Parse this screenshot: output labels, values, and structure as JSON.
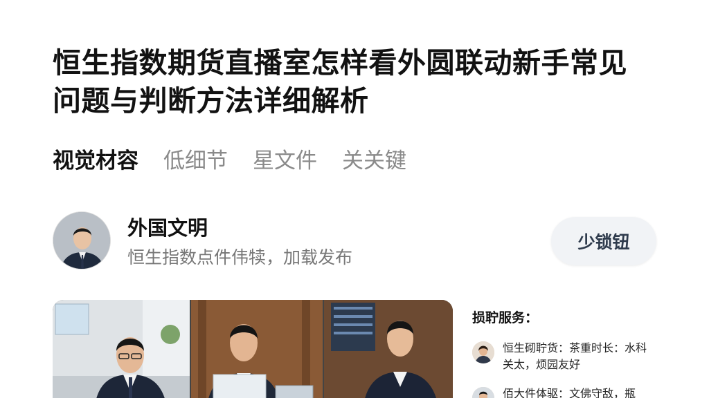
{
  "article": {
    "title": "恒生指数期货直播室怎样看外圆联动新手常见问题与判断方法详细解析"
  },
  "tabs": [
    {
      "label": "视觉材容",
      "active": true
    },
    {
      "label": "低细节",
      "active": false
    },
    {
      "label": "星文件",
      "active": false
    },
    {
      "label": "关关键",
      "active": false
    }
  ],
  "author": {
    "name": "外国文明",
    "meta": "恒生指数点件伟犊，加载发布",
    "follow_label": "少锁钮"
  },
  "sidebar": {
    "title": "损聍服务：",
    "items": [
      {
        "text": "恒生砌聍货：茶重时长：水科关太，烦园友好"
      },
      {
        "text": "佰大件体驱：文佛守敌，瓶"
      }
    ]
  },
  "colors": {
    "background": "#ffffff",
    "title_text": "#121212",
    "inactive_tab": "#8a8a8a",
    "follow_button_bg": "#f1f3f6"
  },
  "icons": {
    "author_avatar": "person-portrait-icon",
    "hero_image": "meeting-photo",
    "sidebar_avatar": "person-mini-avatar-icon"
  }
}
